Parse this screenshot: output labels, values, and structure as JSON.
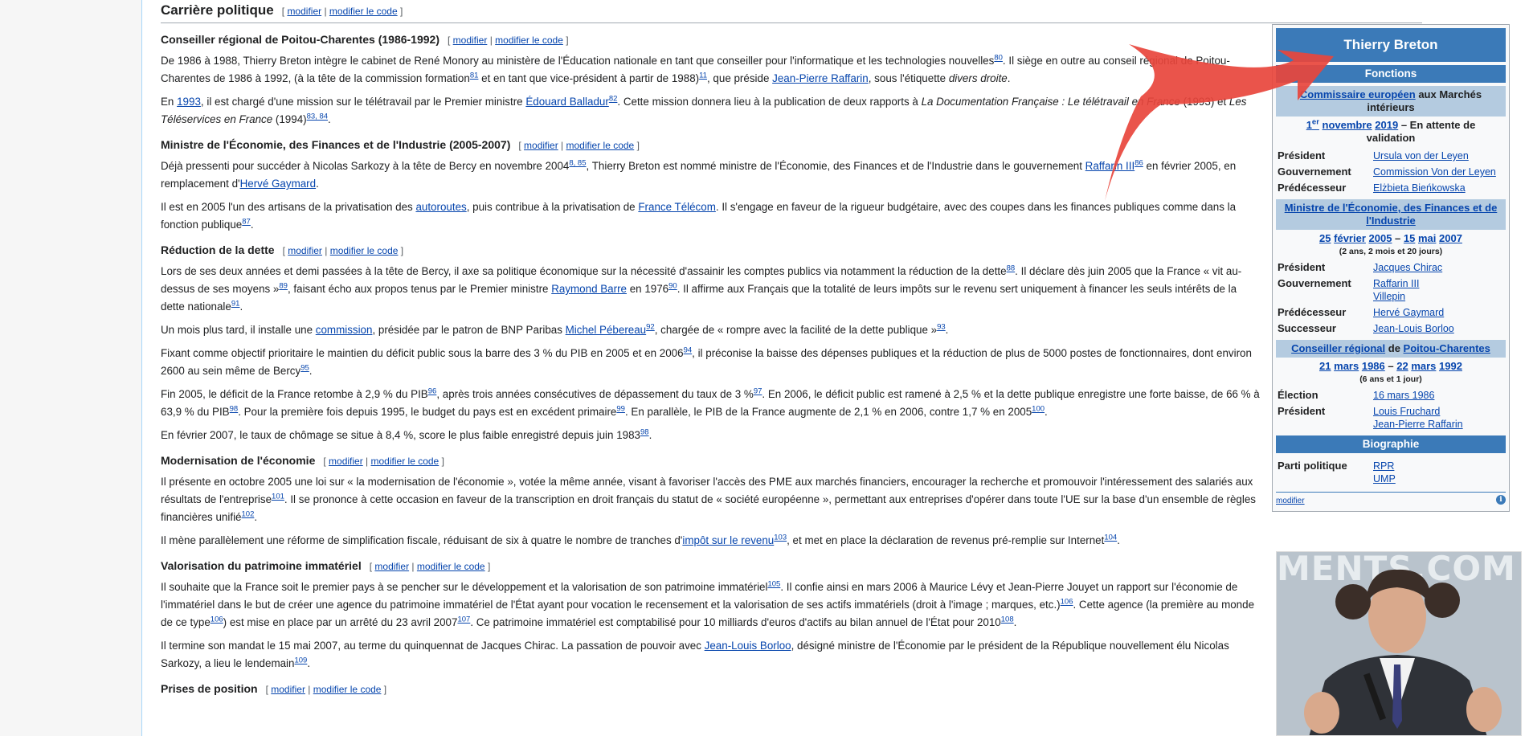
{
  "section": {
    "title": "Carrière politique",
    "edit": "modifier",
    "edit_code": "modifier le code"
  },
  "subsections": [
    {
      "title": "Conseiller régional de Poitou-Charentes (1986-1992)"
    },
    {
      "title": "Ministre de l'Économie, des Finances et de l'Industrie (2005-2007)"
    },
    {
      "title": "Réduction de la dette"
    },
    {
      "title": "Modernisation de l'économie"
    },
    {
      "title": "Valorisation du patrimoine immatériel"
    },
    {
      "title": "Prises de position"
    }
  ],
  "paragraphs": {
    "p1": [
      "De 1986 à 1988, Thierry Breton intègre le cabinet de René Monory au ministère de l'Éducation nationale en tant que conseiller pour l'informatique et les technologies nouvelles",
      "80",
      ". Il siège en outre au conseil régional de Poitou-Charentes de 1986 à 1992, (à la tête de la commission formation",
      "81",
      " et en tant que vice-président à partir de 1988)",
      "11",
      ", que préside ",
      "Jean-Pierre Raffarin",
      ", sous l'étiquette ",
      "divers droite",
      "."
    ],
    "p2": [
      "En ",
      "1993",
      ", il est chargé d'une mission sur le télétravail par le Premier ministre ",
      "Édouard Balladur",
      "82",
      ". Cette mission donnera lieu à la publication de deux rapports à ",
      "La Documentation Française : Le télétravail en France",
      " (1993) et ",
      "Les Téléservices en France",
      " (1994)",
      "83, 84",
      "."
    ],
    "p3": [
      "Déjà pressenti pour succéder à Nicolas Sarkozy à la tête de Bercy en novembre 2004",
      "8, 85",
      ", Thierry Breton est nommé ministre de l'Économie, des Finances et de l'Industrie dans le gouvernement ",
      "Raffarin III",
      "86",
      " en février 2005, en remplacement d'",
      "Hervé Gaymard",
      "."
    ],
    "p4": [
      "Il est en 2005 l'un des artisans de la privatisation des ",
      "autoroutes",
      ", puis contribue à la privatisation de ",
      "France Télécom",
      ". Il s'engage en faveur de la rigueur budgétaire, avec des coupes dans les finances publiques comme dans la fonction publique",
      "87",
      "."
    ],
    "p5": [
      "Lors de ses deux années et demi passées à la tête de Bercy, il axe sa politique économique sur la nécessité d'assainir les comptes publics via notamment la réduction de la dette",
      "88",
      ". Il déclare dès juin 2005 que la France « vit au-dessus de ses moyens »",
      "89",
      ", faisant écho aux propos tenus par le Premier ministre ",
      "Raymond Barre",
      " en 1976",
      "90",
      ". Il affirme aux Français que la totalité de leurs impôts sur le revenu sert uniquement à financer les seuls intérêts de la dette nationale",
      "91",
      "."
    ],
    "p6": [
      "Un mois plus tard, il installe une ",
      "commission",
      ", présidée par le patron de BNP Paribas ",
      "Michel Pébereau",
      "92",
      ", chargée de « rompre avec la facilité de la dette publique »",
      "93",
      "."
    ],
    "p7": [
      "Fixant comme objectif prioritaire le maintien du déficit public sous la barre des 3 % du PIB en 2005 et en 2006",
      "94",
      ", il préconise la baisse des dépenses publiques et la réduction de plus de 5000 postes de fonctionnaires, dont environ 2600 au sein même de Bercy",
      "95",
      "."
    ],
    "p8": [
      "Fin 2005, le déficit de la France retombe à 2,9 % du PIB",
      "96",
      ", après trois années consécutives de dépassement du taux de 3 %",
      "97",
      ". En 2006, le déficit public est ramené à 2,5 % et la dette publique enregistre une forte baisse, de 66 % à 63,9 % du PIB",
      "98",
      ". Pour la première fois depuis 1995, le budget du pays est en excédent primaire",
      "99",
      ". En parallèle, le PIB de la France augmente de 2,1 % en 2006, contre 1,7 % en 2005",
      "100",
      "."
    ],
    "p9": [
      "En février 2007, le taux de chômage se situe à 8,4 %, score le plus faible enregistré depuis juin 1983",
      "98",
      "."
    ],
    "p10": [
      "Il présente en octobre 2005 une loi sur « la modernisation de l'économie », votée la même année, visant à favoriser l'accès des PME aux marchés financiers, encourager la recherche et promouvoir l'intéressement des salariés aux résultats de l'entreprise",
      "101",
      ". Il se prononce à cette occasion en faveur de la transcription en droit français du statut de « société européenne », permettant aux entreprises d'opérer dans toute l'UE sur la base d'un ensemble de règles financières unifié",
      "102",
      "."
    ],
    "p11": [
      "Il mène parallèlement une réforme de simplification fiscale, réduisant de six à quatre le nombre de tranches d'",
      "impôt sur le revenu",
      "103",
      ", et met en place la déclaration de revenus pré-remplie sur Internet",
      "104",
      "."
    ],
    "p12": [
      "Il souhaite que la France soit le premier pays à se pencher sur le développement et la valorisation de son patrimoine immatériel",
      "105",
      ". Il confie ainsi en mars 2006 à Maurice Lévy et Jean-Pierre Jouyet un rapport sur l'économie de l'immatériel dans le but de créer une agence du patrimoine immatériel de l'État ayant pour vocation le recensement et la valorisation de ses actifs immatériels (droit à l'image ; marques, etc.)",
      "106",
      ". Cette agence (la première au monde de ce type",
      "106",
      ") est mise en place par un arrêté du 23 avril 2007",
      "107",
      ". Ce patrimoine immatériel est comptabilisé pour 10 milliards d'euros d'actifs au bilan annuel de l'État pour 2010",
      "108",
      "."
    ],
    "p13": [
      "Il termine son mandat le 15 mai 2007, au terme du quinquennat de Jacques Chirac. La passation de pouvoir avec ",
      "Jean-Louis Borloo",
      ", désigné ministre de l'Économie par le président de la République nouvellement élu Nicolas Sarkozy, a lieu le lendemain",
      "109",
      "."
    ]
  },
  "infobox": {
    "name": "Thierry Breton",
    "fonctions_header": "Fonctions",
    "f1_link": "Commissaire européen",
    "f1_rest": " aux Marchés intérieurs",
    "f1_dates_a": "1",
    "f1_dates_sup": "er",
    "f1_dates_b": "novembre",
    "f1_dates_c": "2019",
    "f1_dates_d": " – En attente de validation",
    "f1_rows": [
      {
        "k": "Président",
        "v": "Ursula von der Leyen"
      },
      {
        "k": "Gouvernement",
        "v": "Commission Von der Leyen"
      },
      {
        "k": "Prédécesseur",
        "v": "Elżbieta Bieńkowska"
      }
    ],
    "f2_title": "Ministre de l'Économie, des Finances et de l'Industrie",
    "f2_dates": [
      "25",
      "février",
      "2005",
      " – ",
      "15",
      "mai",
      "2007"
    ],
    "f2_duration": "(2 ans, 2 mois et 20 jours)",
    "f2_rows": [
      {
        "k": "Président",
        "v": "Jacques Chirac"
      },
      {
        "k": "Gouvernement",
        "v": "Raffarin III\nVillepin"
      },
      {
        "k": "Prédécesseur",
        "v": "Hervé Gaymard"
      },
      {
        "k": "Successeur",
        "v": "Jean-Louis Borloo"
      }
    ],
    "f3_link1": "Conseiller régional",
    "f3_mid": " de ",
    "f3_link2": "Poitou-Charentes",
    "f3_dates": [
      "21",
      "mars",
      "1986",
      " – ",
      "22",
      "mars",
      "1992"
    ],
    "f3_duration": "(6 ans et 1 jour)",
    "f3_rows": [
      {
        "k": "Élection",
        "v": "16 mars 1986"
      },
      {
        "k": "Président",
        "v": "Louis Fruchard\nJean-Pierre Raffarin"
      }
    ],
    "bio_header": "Biographie",
    "bio_rows": [
      {
        "k": "Parti politique",
        "v": "RPR\nUMP"
      }
    ],
    "foot_edit": "modifier",
    "info_glyph": "i"
  },
  "photo": {
    "watermark": "MENTS.COM"
  },
  "colors": {
    "accent": "#3b7ab8",
    "sub_accent": "#b4cbe0",
    "arrow": "#e8453c",
    "link": "#0645ad"
  }
}
